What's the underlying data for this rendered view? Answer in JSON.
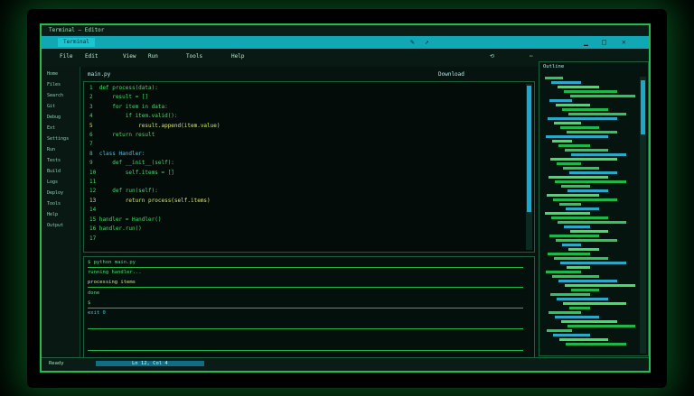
{
  "window": {
    "title": "Terminal — Editor"
  },
  "tab": {
    "label": "Terminal"
  },
  "menu": [
    "File",
    "Edit",
    "View",
    "Run",
    "Tools",
    "Help"
  ],
  "sidebar": {
    "items": [
      "Home",
      "Files",
      "Search",
      "Git",
      "Debug",
      "Ext",
      "Settings",
      "Run",
      "Tests",
      "Build",
      "Logs",
      "Deploy",
      "Tools",
      "Help",
      "Output"
    ]
  },
  "editor": {
    "title": "main.py",
    "button": "Download"
  },
  "right_panel": {
    "title": "Outline"
  },
  "status": {
    "left": "Ready",
    "mid": "Ln 12, Col 4"
  },
  "colors": {
    "accent": "#1fbf4a",
    "tabs": "#12a7b5",
    "code_green": "#3cdc6a",
    "code_yellow": "#d8e85a",
    "code_cyan": "#39c8e0"
  }
}
